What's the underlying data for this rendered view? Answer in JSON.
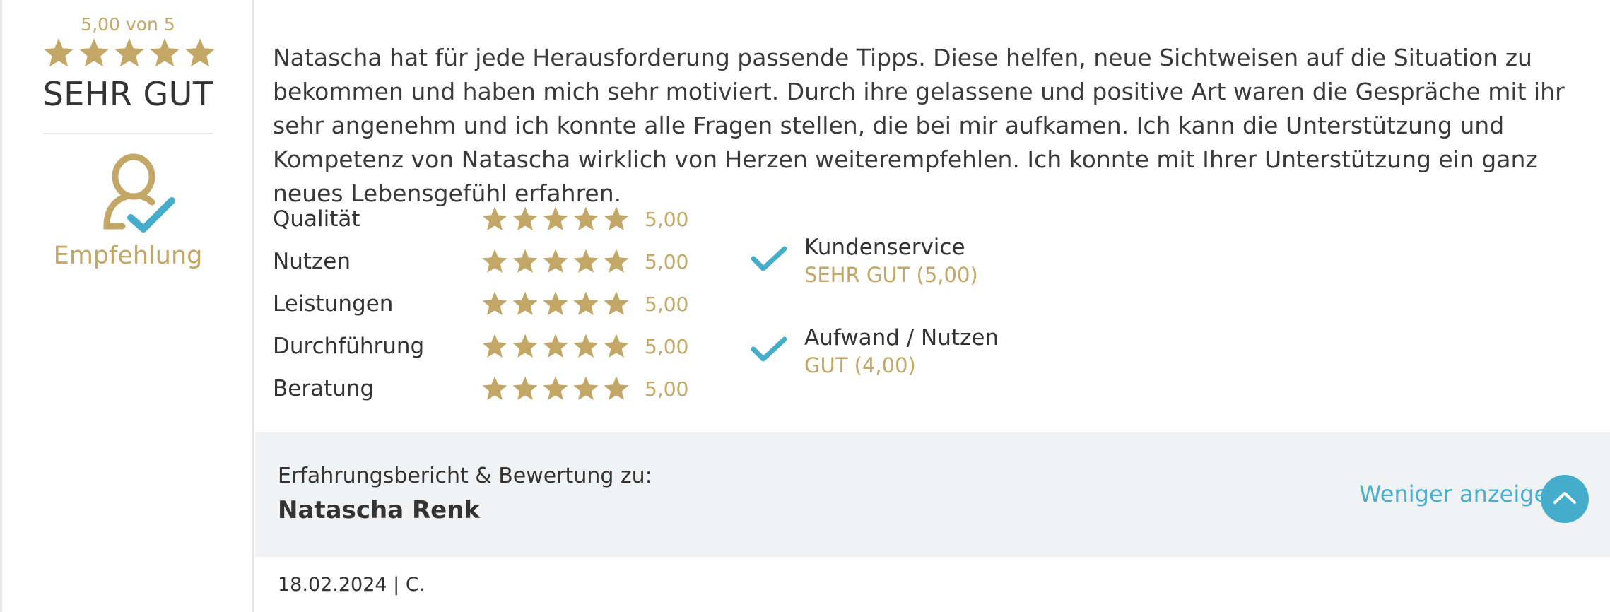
{
  "rating": {
    "score_text": "5,00 von 5",
    "stars": 5,
    "verdict": "SEHR GUT",
    "badge_icon": "user-check-icon",
    "badge_label": "Empfehlung"
  },
  "review": {
    "text": "Natascha hat für jede Herausforderung passende Tipps. Diese helfen, neue Sichtweisen auf die Situation zu bekommen und haben mich sehr motiviert. Durch ihre gelassene und positive Art waren die Gespräche mit ihr sehr angenehm und ich konnte alle Fragen stellen, die bei mir aufkamen. Ich kann die Unterstützung und Kompetenz von Natascha wirklich von Herzen weiterempfehlen. Ich konnte mit Ihrer Unterstützung ein ganz neues Lebensgefühl erfahren."
  },
  "criteria": [
    {
      "label": "Qualität",
      "value": "5,00",
      "stars": 5
    },
    {
      "label": "Nutzen",
      "value": "5,00",
      "stars": 5
    },
    {
      "label": "Leistungen",
      "value": "5,00",
      "stars": 5
    },
    {
      "label": "Durchführung",
      "value": "5,00",
      "stars": 5
    },
    {
      "label": "Beratung",
      "value": "5,00",
      "stars": 5
    }
  ],
  "aspects": [
    {
      "name": "Kundenservice",
      "grade": "SEHR GUT (5,00)",
      "icon": "check-icon"
    },
    {
      "name": "Aufwand / Nutzen",
      "grade": "GUT (4,00)",
      "icon": "check-icon"
    }
  ],
  "footer": {
    "label": "Erfahrungsbericht & Bewertung zu:",
    "name": "Natascha Renk",
    "toggle_label": "Weniger anzeigen",
    "toggle_icon": "chevron-up-icon"
  },
  "meta": {
    "line": "18.02.2024 | C."
  },
  "colors": {
    "gold": "#c2a766",
    "accent": "#45adcb",
    "text": "#333333",
    "footer_bg": "#f1f2f4"
  }
}
